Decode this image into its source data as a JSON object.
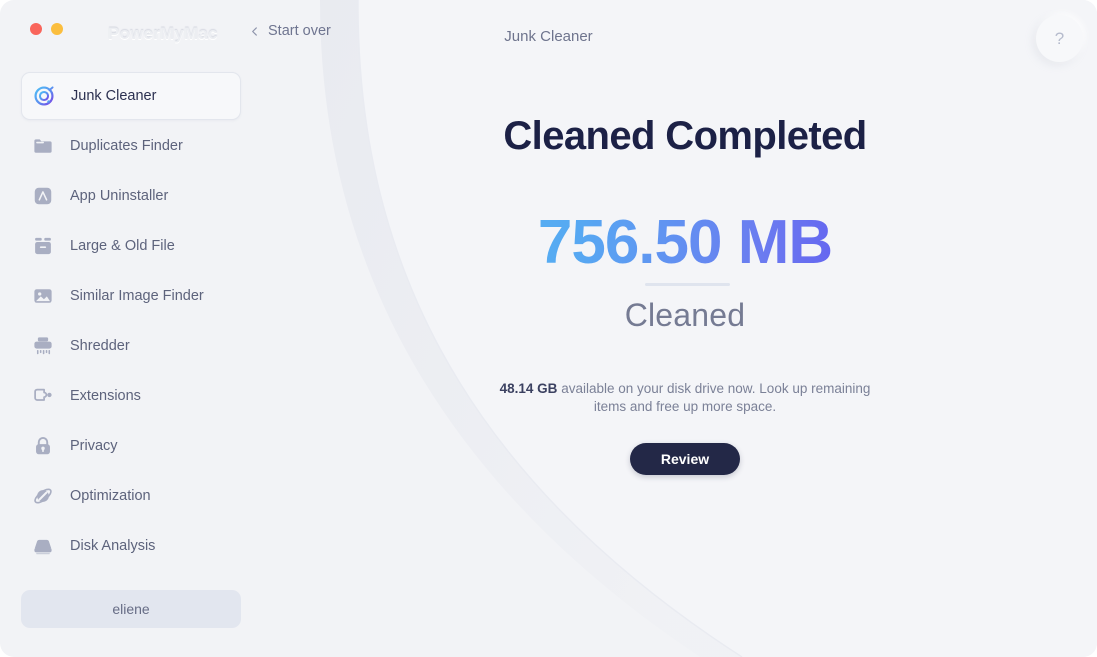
{
  "window": {
    "brand": "PowerMyMac",
    "title": "Junk Cleaner",
    "start_over_label": "Start over",
    "help_label": "?",
    "traffic_lights": [
      "close",
      "minimize"
    ],
    "accent_gradient_start": "#4fc0f5",
    "accent_gradient_end": "#5533ee",
    "background": "#f2f3f6"
  },
  "sidebar": {
    "items": [
      {
        "label": "Junk Cleaner",
        "icon": "junk-cleaner-icon",
        "active": true
      },
      {
        "label": "Duplicates Finder",
        "icon": "folder-icon",
        "active": false
      },
      {
        "label": "App Uninstaller",
        "icon": "app-store-icon",
        "active": false
      },
      {
        "label": "Large & Old File",
        "icon": "archive-box-icon",
        "active": false
      },
      {
        "label": "Similar Image Finder",
        "icon": "image-icon",
        "active": false
      },
      {
        "label": "Shredder",
        "icon": "shredder-icon",
        "active": false
      },
      {
        "label": "Extensions",
        "icon": "puzzle-plug-icon",
        "active": false
      },
      {
        "label": "Privacy",
        "icon": "lock-icon",
        "active": false
      },
      {
        "label": "Optimization",
        "icon": "optimization-orbit-icon",
        "active": false
      },
      {
        "label": "Disk Analysis",
        "icon": "hard-drive-icon",
        "active": false
      }
    ],
    "account": {
      "label": "eliene"
    }
  },
  "main": {
    "headline": "Cleaned Completed",
    "amount": "756.50 MB",
    "amount_caption": "Cleaned",
    "free_space": "48.14 GB",
    "note": "available on your disk drive now. Look up remaining items and free up more space.",
    "review_label": "Review"
  }
}
